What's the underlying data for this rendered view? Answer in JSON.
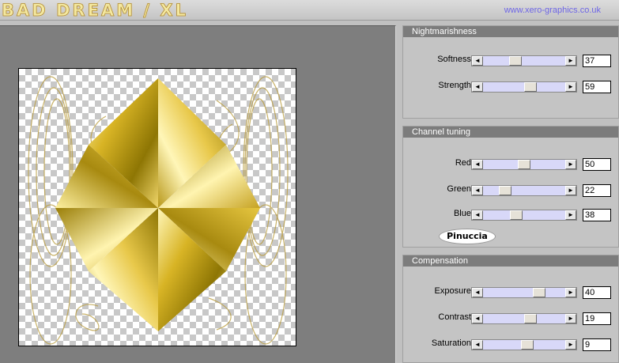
{
  "header": {
    "title": "BAD DREAM / XL",
    "website": "www.xero-graphics.co.uk"
  },
  "panels": {
    "nightmarishness": {
      "title": "Nightmarishness",
      "controls": [
        {
          "label": "Softness",
          "value": "37",
          "fraction": 0.37
        },
        {
          "label": "Strength",
          "value": "59",
          "fraction": 0.59
        }
      ]
    },
    "channel_tuning": {
      "title": "Channel tuning",
      "controls": [
        {
          "label": "Red",
          "value": "50",
          "fraction": 0.5
        },
        {
          "label": "Green",
          "value": "22",
          "fraction": 0.22
        },
        {
          "label": "Blue",
          "value": "38",
          "fraction": 0.38
        }
      ],
      "watermark": "Pinuccia"
    },
    "compensation": {
      "title": "Compensation",
      "controls": [
        {
          "label": "Exposure",
          "value": "40",
          "fraction": 0.72
        },
        {
          "label": "Contrast",
          "value": "19",
          "fraction": 0.59
        },
        {
          "label": "Saturation",
          "value": "9",
          "fraction": 0.55
        }
      ]
    }
  },
  "icons": {
    "left_arrow": "◄",
    "right_arrow": "►"
  },
  "colors": {
    "accent_link": "#6e66e6",
    "slider_track": "#d8d8f8",
    "panel_header": "#7c7c7c",
    "preview_bg": "#7e7e7e",
    "gold_dark": "#8e7604",
    "gold_light": "#fff6b8"
  }
}
